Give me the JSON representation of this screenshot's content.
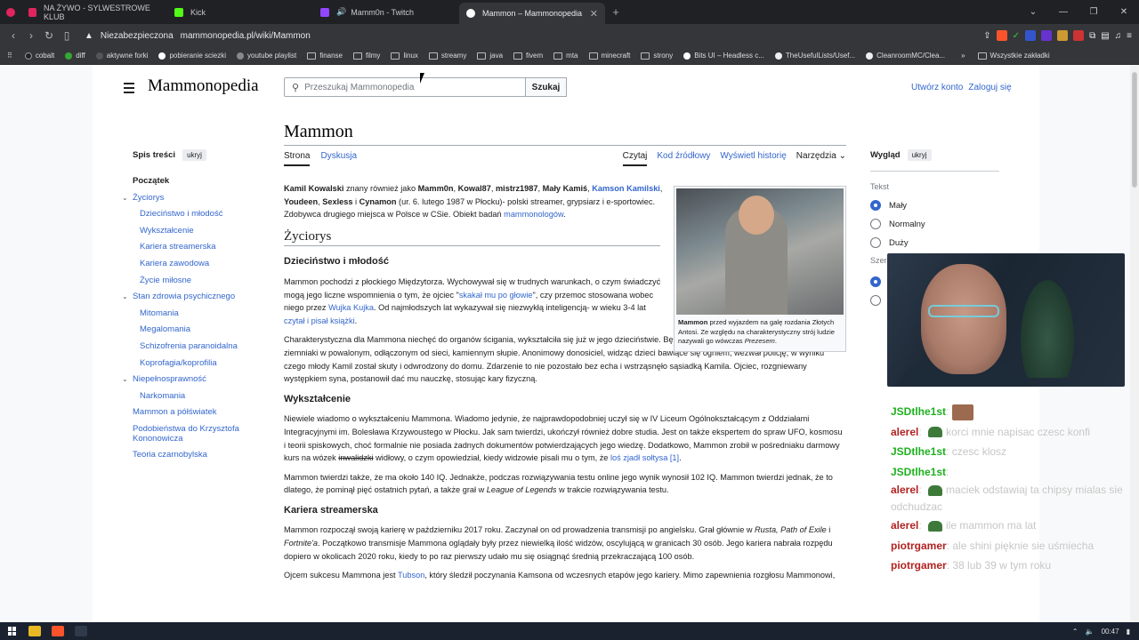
{
  "browser": {
    "tabs": [
      {
        "label": "NA ŻYWO - SYLWESTROWE KLUB",
        "color": "#e0245e",
        "active": false
      },
      {
        "label": "Kick",
        "color": "#53fc18",
        "active": false
      },
      {
        "label": "Mamm0n - Twitch",
        "color": "#9146ff",
        "active": false
      },
      {
        "label": "Mammon – Mammonopedia",
        "color": "#ffffff",
        "active": true
      }
    ],
    "new_tab": "+",
    "security_label": "Niezabezpieczona",
    "url": "mammonopedia.pl/wiki/Mammon",
    "bookmarks": [
      "cobalt",
      "diff",
      "aktywne forki",
      "pobieranie sciezki",
      "youtube playlist",
      "finanse",
      "filmy",
      "linux",
      "streamy",
      "java",
      "fivem",
      "mta",
      "minecraft",
      "strony",
      "Bits UI – Headless c...",
      "TheUsefulLists/Usef...",
      "CleanroomMC/Clea..."
    ],
    "bookmarks_more": "»",
    "all_bookmarks": "Wszystkie zakładki"
  },
  "wiki": {
    "logo": "Mammonopedia",
    "search_placeholder": "Przeszukaj Mammonopedia",
    "search_button": "Szukaj",
    "create_account": "Utwórz konto",
    "login": "Zaloguj się",
    "toc_title": "Spis treści",
    "toc_hide": "ukryj",
    "toc": [
      {
        "label": "Początek",
        "level": 1,
        "current": true
      },
      {
        "label": "Życiorys",
        "level": 1,
        "chev": true
      },
      {
        "label": "Dzieciństwo i młodość",
        "level": 2
      },
      {
        "label": "Wykształcenie",
        "level": 2
      },
      {
        "label": "Kariera streamerska",
        "level": 2
      },
      {
        "label": "Kariera zawodowa",
        "level": 2
      },
      {
        "label": "Życie miłosne",
        "level": 2
      },
      {
        "label": "Stan zdrowia psychicznego",
        "level": 1,
        "chev": true
      },
      {
        "label": "Mitomania",
        "level": 2
      },
      {
        "label": "Megalomania",
        "level": 2
      },
      {
        "label": "Schizofrenia paranoidalna",
        "level": 2
      },
      {
        "label": "Koprofagia/koprofilia",
        "level": 2
      },
      {
        "label": "Niepełnosprawność",
        "level": 1,
        "chev": true
      },
      {
        "label": "Narkomania",
        "level": 2
      },
      {
        "label": "Mammon a półświatek",
        "level": 1
      },
      {
        "label": "Podobieństwa do Krzysztofa Kononowicza",
        "level": 1
      },
      {
        "label": "Teoria czarnobylska",
        "level": 1
      }
    ],
    "page_title": "Mammon",
    "tab_article": "Strona",
    "tab_talk": "Dyskusja",
    "action_read": "Czytaj",
    "action_source": "Kod źródłowy",
    "action_history": "Wyświetl historię",
    "action_tools": "Narzędzia",
    "intro_bold1": "Kamil Kowalski",
    "intro_t1": " znany również jako ",
    "intro_bold2": "Mamm0n",
    "intro_t2": ", ",
    "intro_bold3": "Kowal87",
    "intro_bold4": "mistrz1987",
    "intro_bold5": "Mały Kamiś",
    "intro_link1": "Kamson Kamilski",
    "intro_bold6": "Youdeen",
    "intro_bold7": "Sexless",
    "intro_t3": " i ",
    "intro_bold8": "Cynamon",
    "intro_t4": " (ur. 6. lutego 1987 w Płocku)- polski streamer, grypsiarz i e-sportowiec. Zdobywca drugiego miejsca w Polsce w CSie. Obiekt badań ",
    "intro_link2": "mammonologów",
    "intro_end": ".",
    "h_zyciorys": "Życiorys",
    "h_dziecinstwo": "Dzieciństwo i młodość",
    "p1_a": "Mammon pochodzi z płockiego Międzytorza. Wychowywał się w trudnych warunkach, o czym świadczyć mogą jego liczne wspomnienia o tym, że ojciec \"",
    "p1_link": "skakał mu po głowie",
    "p1_b": "\", czy przemoc stosowana wobec niego przez ",
    "p1_link2": "Wujka Kujka",
    "p1_c": ". Od najmłodszych lat wykazywał się niezwykłą inteligencją- w wieku 3-4 lat ",
    "p1_link3": "czytał i pisał książki",
    "p1_d": ".",
    "p2": "Charakterystyczna dla Mammona niechęć do organów ścigania, wykształciła się już w jego dzieciństwie. Będąc młodym, wraz z kolegą Jurkiem, piekł on ziemniaki w powalonym, odłączonym od sieci, kamiennym słupie. Anonimowy donosiciel, widząc dzieci bawiące się ogniem, wezwał policję, w wyniku czego młody Kamil został skuty i odwrodzony do domu. Zdarzenie to nie pozostało bez echa i wstrząsnęło sąsiadką Kamila. Ojciec, rozgniewany występkiem syna, postanowił dać mu nauczkę, stosując kary fizyczną.",
    "h_wyksztalcenie": "Wykształcenie",
    "p3_a": "Niewiele wiadomo o wykształceniu Mammona. Wiadomo jedynie, że najprawdopodobniej uczył się w IV Liceum Ogólnokształcącym z Oddziałami Integracyjnymi im. Bolesława Krzywoustego w Płocku. Jak sam twierdzi, ukończył również dobre studia. Jest on także ekspertem do spraw UFO, kosmosu i teorii spiskowych, choć formalnie nie posiada żadnych dokumentów potwierdzających jego wiedzę. Dodatkowo, Mammon zrobił w pośredniaku darmowy kurs na wózek ",
    "p3_strike": "inwalidzki",
    "p3_b": " widłowy, o czym opowiedział, kiedy widzowie pisali mu o tym, że ",
    "p3_link": "loś zjadł sołtysa [1]",
    "p3_c": ".",
    "p4_a": "Mammon twierdzi także, że ma około 140 IQ. Jednakże, podczas rozwiązywania testu online jego wynik wynosił 102 IQ. Mammon twierdzi jednak, że to dlatego, że pominął pięć ostatnich pytań, a także grał w ",
    "p4_it": "League of Legends",
    "p4_b": " w trakcie rozwiązywania testu.",
    "h_kariera": "Kariera streamerska",
    "p5_a": "Mammon rozpoczął swoją karierę w październiku 2017 roku. Zaczynał on od prowadzenia transmisji po angielsku. Grał głównie w ",
    "p5_it": "Rusta, Path of Exile",
    "p5_b": " i ",
    "p5_it2": "Fortnite'a",
    "p5_c": ". Początkowo transmisje Mammona oglądały były przez niewielką ilość widzów, oscylującą w granicach 30 osób. Jego kariera nabrała rozpędu dopiero w okolicach 2020 roku, kiedy to po raz pierwszy udało mu się osiągnąć średnią przekraczającą 100 osób.",
    "p6_a": "Ojcem sukcesu Mammona jest ",
    "p6_link": "Tubson",
    "p6_b": ", który śledził poczynania Kamsona od wczesnych etapów jego kariery. Mimo zapewnienia rozgłosu Mammonowi,",
    "caption_bold": "Mammon",
    "caption_a": " przed wyjazdem na galę rozdania Złotych Antosi. Ze względu na charakterystyczny strój ludzie nazywali go wówczas ",
    "caption_it": "Prezesem",
    "caption_end": ".",
    "appearance_title": "Wygląd",
    "appearance_hide": "ukryj",
    "text_label": "Tekst",
    "size_options": [
      "Mały",
      "Normalny",
      "Duży"
    ],
    "selected_size": "Mały",
    "width_label": "Szer"
  },
  "chat": [
    {
      "user": "JSDtlhe1st",
      "color": "#1fb01f",
      "message": "",
      "emote": "picture"
    },
    {
      "user": "alerel",
      "color": "#b22222",
      "message": "korci mnie napisac czesc konfi",
      "emote": "pepe"
    },
    {
      "user": "JSDtlhe1st",
      "color": "#1fb01f",
      "message": "czesc klosz",
      "emote": ""
    },
    {
      "user": "JSDtlhe1st",
      "color": "#1fb01f",
      "message": "",
      "emote": ""
    },
    {
      "user": "alerel",
      "color": "#b22222",
      "message": "maciek odstawiaj ta chipsy mialas sie odchudzac",
      "emote": "pepe"
    },
    {
      "user": "alerel",
      "color": "#b22222",
      "message": "ile mammon ma lat",
      "emote": "pepe"
    },
    {
      "user": "piotrgamer",
      "color": "#b22222",
      "message": "ale shini pięknie sie uśmiecha",
      "emote": ""
    },
    {
      "user": "piotrgamer",
      "color": "#b22222",
      "message": "38 lub 39 w tym roku",
      "emote": ""
    }
  ],
  "taskbar": {
    "time": "00:47"
  }
}
